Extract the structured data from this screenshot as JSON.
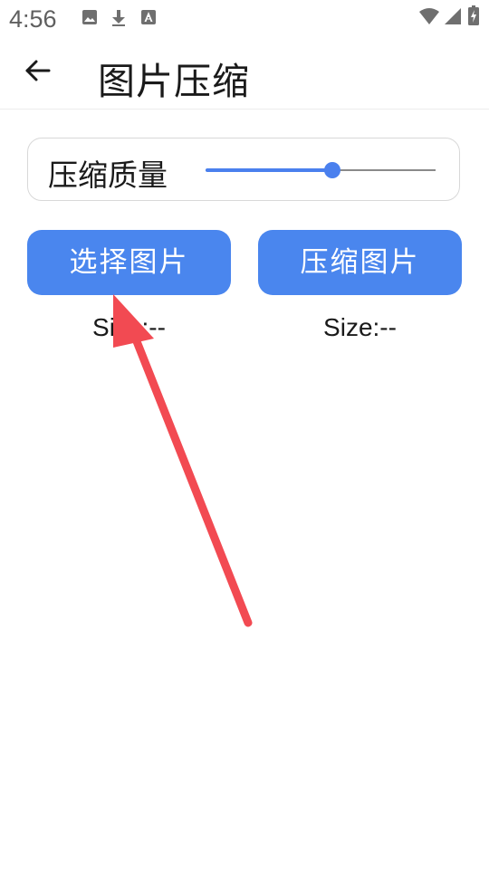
{
  "status_bar": {
    "time": "4:56",
    "icons": [
      "image-icon",
      "download-icon",
      "a-badge-icon",
      "wifi-icon",
      "signal-icon",
      "battery-icon"
    ]
  },
  "app_bar": {
    "back_icon": "arrow-left-icon",
    "title": "图片压缩"
  },
  "quality": {
    "label": "压缩质量",
    "slider_value_percent": 55,
    "accent_color": "#4a80ee"
  },
  "actions": {
    "select_label": "选择图片",
    "compress_label": "压缩图片",
    "button_color": "#4a86ee"
  },
  "sizes": {
    "original": "Size:--",
    "compressed": "Size:--"
  },
  "annotation": {
    "arrow_color": "#f24a52"
  }
}
